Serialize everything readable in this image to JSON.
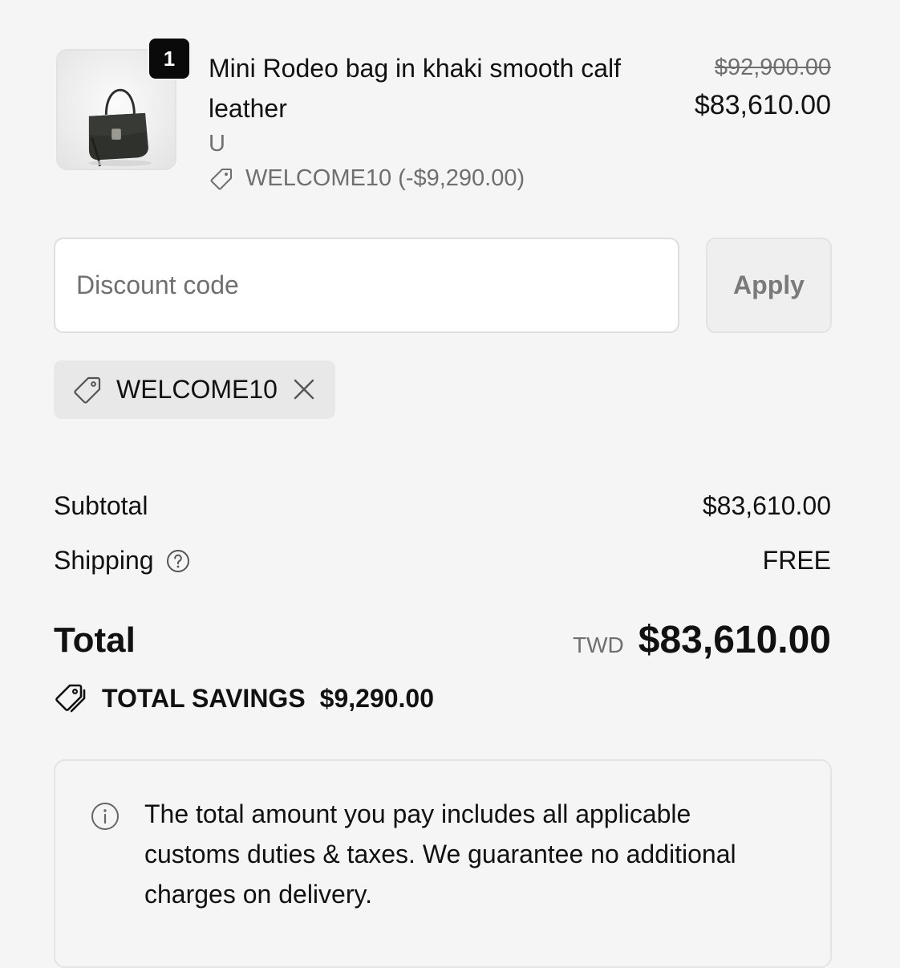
{
  "line_item": {
    "quantity": "1",
    "title": "Mini Rodeo bag in khaki smooth calf leather",
    "variant": "U",
    "discount_applied": "WELCOME10 (-$9,290.00)",
    "price_original": "$92,900.00",
    "price_current": "$83,610.00",
    "thumbnail_icon": "handbag-image"
  },
  "discount": {
    "placeholder": "Discount code",
    "value": "",
    "apply_label": "Apply",
    "applied_code": "WELCOME10"
  },
  "summary": {
    "subtotal_label": "Subtotal",
    "subtotal_value": "$83,610.00",
    "shipping_label": "Shipping",
    "shipping_value": "FREE",
    "total_label": "Total",
    "currency_code": "TWD",
    "total_value": "$83,610.00",
    "savings_label": "TOTAL SAVINGS",
    "savings_value": "$9,290.00"
  },
  "notice": {
    "text": "The total amount you pay includes all applicable customs duties & taxes. We guarantee no additional charges on delivery."
  },
  "colors": {
    "background": "#f5f5f5",
    "text_primary": "#111111",
    "text_secondary": "#6f6f6f",
    "badge": "#0a0a0a"
  }
}
